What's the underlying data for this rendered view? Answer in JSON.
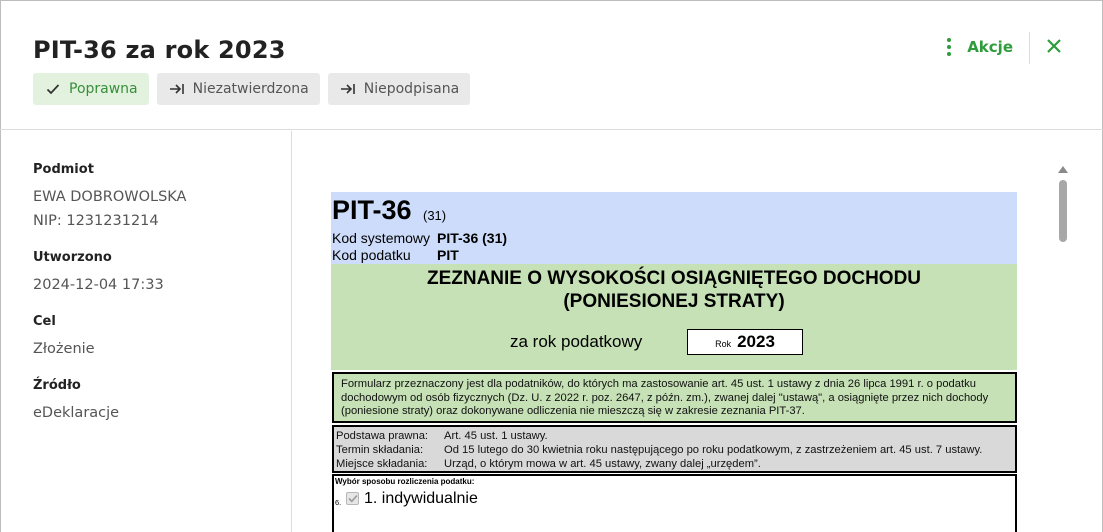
{
  "header": {
    "title": "PIT-36 za rok 2023",
    "badges": [
      {
        "label": "Poprawna",
        "icon": "check-icon",
        "color": "#388e3c"
      },
      {
        "label": "Niezatwierdzona",
        "icon": "arrow-to-line-icon"
      },
      {
        "label": "Niepodpisana",
        "icon": "arrow-to-line-icon"
      }
    ],
    "actions_label": "Akcje",
    "accent_color": "#2e9c3b"
  },
  "sidebar": {
    "fields": [
      {
        "label": "Podmiot",
        "values": [
          "EWA DOBROWOLSKA",
          "NIP: 1231231214"
        ]
      },
      {
        "label": "Utworzono",
        "values": [
          "2024-12-04 17:33"
        ]
      },
      {
        "label": "Cel",
        "values": [
          "Złożenie"
        ]
      },
      {
        "label": "Źródło",
        "values": [
          "eDeklaracje"
        ]
      }
    ]
  },
  "form": {
    "code": "PIT-36",
    "version": "(31)",
    "system_code_label": "Kod systemowy",
    "system_code_value": "PIT-36 (31)",
    "tax_code_label": "Kod podatku",
    "tax_code_value": "PIT",
    "heading_line1": "ZEZNANIE O WYSOKOŚCI OSIĄGNIĘTEGO DOCHODU",
    "heading_line2": "(PONIESIONEJ STRATY)",
    "tax_year_label": "za rok podatkowy",
    "year_small_label": "Rok",
    "year_value": "2023",
    "note": "Formularz przeznaczony jest dla podatników, do których ma zastosowanie art. 45 ust. 1 ustawy z dnia 26 lipca 1991 r. o podatku dochodowym od osób fizycznych (Dz. U. z 2022 r. poz. 2647, z późn. zm.), zwanej dalej \"ustawą\", a osiągnięte przez nich dochody (poniesione straty) oraz dokonywane odliczenia nie mieszczą się w zakresie zeznania PIT-37.",
    "info": [
      {
        "key": "Podstawa prawna:",
        "value": "Art. 45 ust. 1 ustawy."
      },
      {
        "key": "Termin składania:",
        "value": "Od 15 lutego do 30 kwietnia roku następującego po roku podatkowym, z zastrzeżeniem art. 45 ust. 7 ustawy."
      },
      {
        "key": "Miejsce składania:",
        "value": "Urząd, o którym mowa w art. 45 ustawy, zwany dalej „urzędem”."
      }
    ],
    "choice_title": "Wybór sposobu rozliczenia podatku:",
    "choice_number": "6.",
    "choice_option": "1. indywidualnie",
    "choice_checked": true,
    "colors": {
      "header_blue": "#cddcfa",
      "section_green": "#c6e1b6",
      "info_gray": "#d9d9d9"
    }
  }
}
